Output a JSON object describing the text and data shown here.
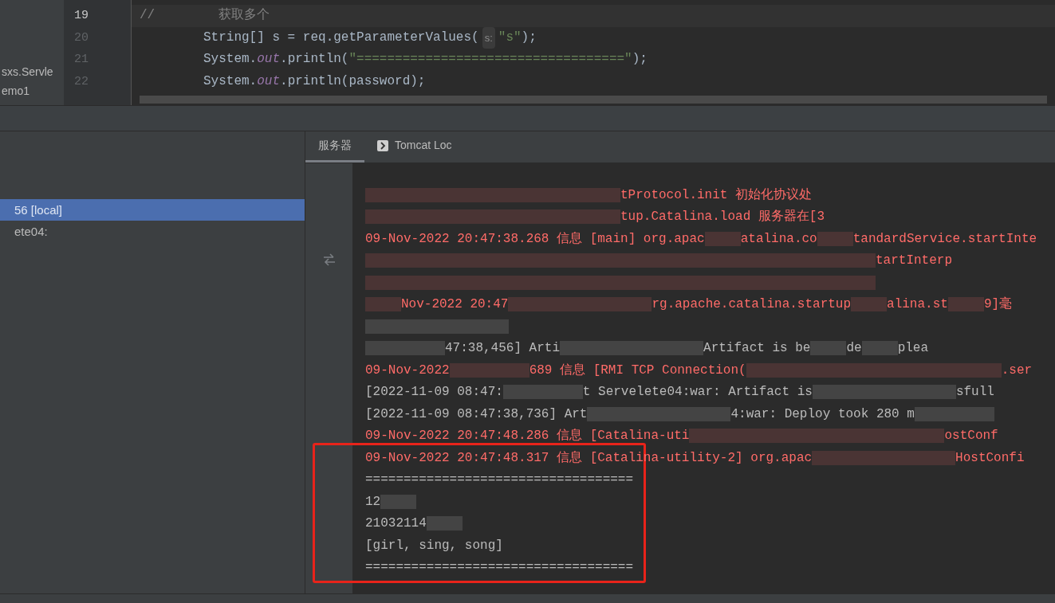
{
  "project_tree": {
    "items": [
      {
        "label": "sxs.Servle"
      },
      {
        "label": "emo1"
      }
    ]
  },
  "editor": {
    "lines": [
      {
        "number": "19",
        "current": true,
        "kind": "comment",
        "parts": [
          {
            "kind": "comment",
            "text": "//"
          },
          {
            "kind": "comment_cn",
            "text": "获取多个"
          }
        ]
      },
      {
        "number": "20",
        "current": false,
        "kind": "code",
        "parts": [
          {
            "kind": "plain",
            "text": "String[] s = req.getParameterValues("
          },
          {
            "kind": "hint",
            "text": "s:"
          },
          {
            "kind": "string",
            "text": "\"s\""
          },
          {
            "kind": "plain",
            "text": ");"
          }
        ]
      },
      {
        "number": "21",
        "current": false,
        "kind": "code",
        "parts": [
          {
            "kind": "plain",
            "text": "System."
          },
          {
            "kind": "field",
            "text": "out"
          },
          {
            "kind": "plain",
            "text": ".println("
          },
          {
            "kind": "string",
            "text": "\"===================================\""
          },
          {
            "kind": "plain",
            "text": ");"
          }
        ]
      },
      {
        "number": "22",
        "current": false,
        "kind": "code",
        "parts": [
          {
            "kind": "plain",
            "text": "System."
          },
          {
            "kind": "field",
            "text": "out"
          },
          {
            "kind": "plain",
            "text": ".println(password);"
          }
        ]
      }
    ]
  },
  "services": {
    "tree": [
      {
        "label": "56 [local]",
        "selected": true
      },
      {
        "label": "ete04:",
        "selected": false
      }
    ],
    "tabs": [
      {
        "label": "服务器",
        "selected": true
      },
      {
        "label": "Tomcat Loc",
        "selected": false
      }
    ],
    "console": [
      {
        "kind": "info",
        "segments": [
          {
            "kind": "xlong"
          },
          {
            "kind": "text",
            "text": "tProtocol.init 初始化协议处"
          }
        ]
      },
      {
        "kind": "info",
        "segments": [
          {
            "kind": "xlong"
          },
          {
            "kind": "text",
            "text": "tup.Catalina.load 服务器在[3"
          }
        ]
      },
      {
        "kind": "info",
        "segments": [
          {
            "kind": "text",
            "text": "09-Nov-2022 20:47:38.268 信息 [main] org.apac"
          },
          {
            "kind": "short"
          },
          {
            "kind": "text",
            "text": "atalina.co"
          },
          {
            "kind": "short"
          },
          {
            "kind": "text",
            "text": "tandardService.startInte"
          }
        ]
      },
      {
        "kind": "info",
        "segments": [
          {
            "kind": "xlong"
          },
          {
            "kind": "xlong"
          },
          {
            "kind": "text",
            "text": "tartInterp"
          }
        ]
      },
      {
        "kind": "info",
        "segments": [
          {
            "kind": "xlong"
          },
          {
            "kind": "xlong"
          }
        ]
      },
      {
        "kind": "info",
        "segments": [
          {
            "kind": "short"
          },
          {
            "kind": "text",
            "text": "Nov-2022 20:47"
          },
          {
            "kind": "long"
          },
          {
            "kind": "text",
            "text": "rg.apache.catalina.startup"
          },
          {
            "kind": "short"
          },
          {
            "kind": "text",
            "text": "alina.st"
          },
          {
            "kind": "short"
          },
          {
            "kind": "text",
            "text": "9]毫"
          }
        ]
      },
      {
        "kind": "plain",
        "segments": [
          {
            "kind": "long"
          }
        ]
      },
      {
        "kind": "plain",
        "segments": [
          {
            "kind": "medium"
          },
          {
            "kind": "text",
            "text": "47:38,456] Arti"
          },
          {
            "kind": "long"
          },
          {
            "kind": "text",
            "text": "Artifact is be"
          },
          {
            "kind": "short"
          },
          {
            "kind": "text",
            "text": "de"
          },
          {
            "kind": "short"
          },
          {
            "kind": "text",
            "text": "plea"
          }
        ]
      },
      {
        "kind": "info",
        "segments": [
          {
            "kind": "text",
            "text": "09-Nov-2022"
          },
          {
            "kind": "medium"
          },
          {
            "kind": "text",
            "text": "689 信息 [RMI TCP Connection("
          },
          {
            "kind": "xlong"
          },
          {
            "kind": "text",
            "text": ".ser"
          }
        ]
      },
      {
        "kind": "plain",
        "segments": [
          {
            "kind": "text",
            "text": "[2022-11-09 08:47:"
          },
          {
            "kind": "medium"
          },
          {
            "kind": "text",
            "text": "t Servelete04:war: Artifact is"
          },
          {
            "kind": "long"
          },
          {
            "kind": "text",
            "text": "sfull"
          }
        ]
      },
      {
        "kind": "plain",
        "segments": [
          {
            "kind": "text",
            "text": "[2022-11-09 08:47:38,736] Art"
          },
          {
            "kind": "long"
          },
          {
            "kind": "text",
            "text": "4:war: Deploy took 280 m"
          },
          {
            "kind": "medium"
          }
        ]
      },
      {
        "kind": "info",
        "segments": [
          {
            "kind": "text",
            "text": "09-Nov-2022 20:47:48.286 信息 [Catalina-uti"
          },
          {
            "kind": "xlong"
          },
          {
            "kind": "text",
            "text": "ostConf"
          }
        ]
      },
      {
        "kind": "info",
        "segments": [
          {
            "kind": "text",
            "text": "09-Nov-2022 20:47:48.317 信息 [Catalina-utility-2] org.apac"
          },
          {
            "kind": "long"
          },
          {
            "kind": "text",
            "text": "HostConfi"
          }
        ]
      },
      {
        "kind": "plain",
        "segments": [
          {
            "kind": "text",
            "text": "==================================="
          }
        ]
      },
      {
        "kind": "plain",
        "segments": [
          {
            "kind": "text",
            "text": "12"
          },
          {
            "kind": "short"
          }
        ]
      },
      {
        "kind": "plain",
        "segments": [
          {
            "kind": "text",
            "text": "21032114"
          },
          {
            "kind": "short"
          }
        ]
      },
      {
        "kind": "plain",
        "segments": [
          {
            "kind": "text",
            "text": "[girl, sing, song]"
          }
        ]
      },
      {
        "kind": "plain",
        "segments": [
          {
            "kind": "text",
            "text": "==================================="
          }
        ]
      }
    ]
  }
}
